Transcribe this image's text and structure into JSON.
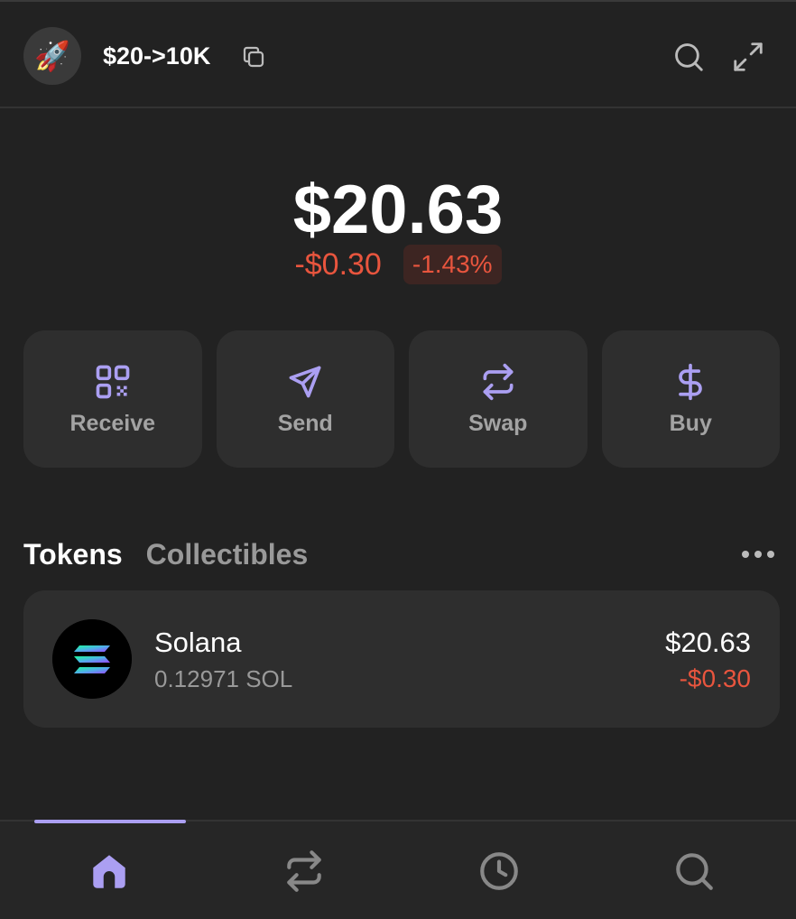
{
  "header": {
    "avatar_emoji": "🚀",
    "account_name": "$20->10K",
    "icons": [
      "copy-icon",
      "search-icon",
      "expand-icon"
    ]
  },
  "balance": {
    "total": "$20.63",
    "change_value": "-$0.30",
    "change_percent": "-1.43%"
  },
  "actions": [
    {
      "label": "Receive",
      "icon": "qr-code-icon"
    },
    {
      "label": "Send",
      "icon": "send-icon"
    },
    {
      "label": "Swap",
      "icon": "swap-icon"
    },
    {
      "label": "Buy",
      "icon": "dollar-icon"
    }
  ],
  "tabs": {
    "tokens": "Tokens",
    "collectibles": "Collectibles",
    "active": "Tokens"
  },
  "tokens": [
    {
      "name": "Solana",
      "amount": "0.12971 SOL",
      "value": "$20.63",
      "change": "-$0.30",
      "icon": "solana-logo"
    }
  ],
  "bottom_nav": {
    "items": [
      "home-icon",
      "swap-icon",
      "history-icon",
      "search-icon"
    ],
    "active": "home-icon"
  },
  "colors": {
    "background": "#222222",
    "card": "#2e2e2e",
    "accent": "#ab9ff2",
    "negative": "#e8553e",
    "muted_text": "#999999"
  }
}
